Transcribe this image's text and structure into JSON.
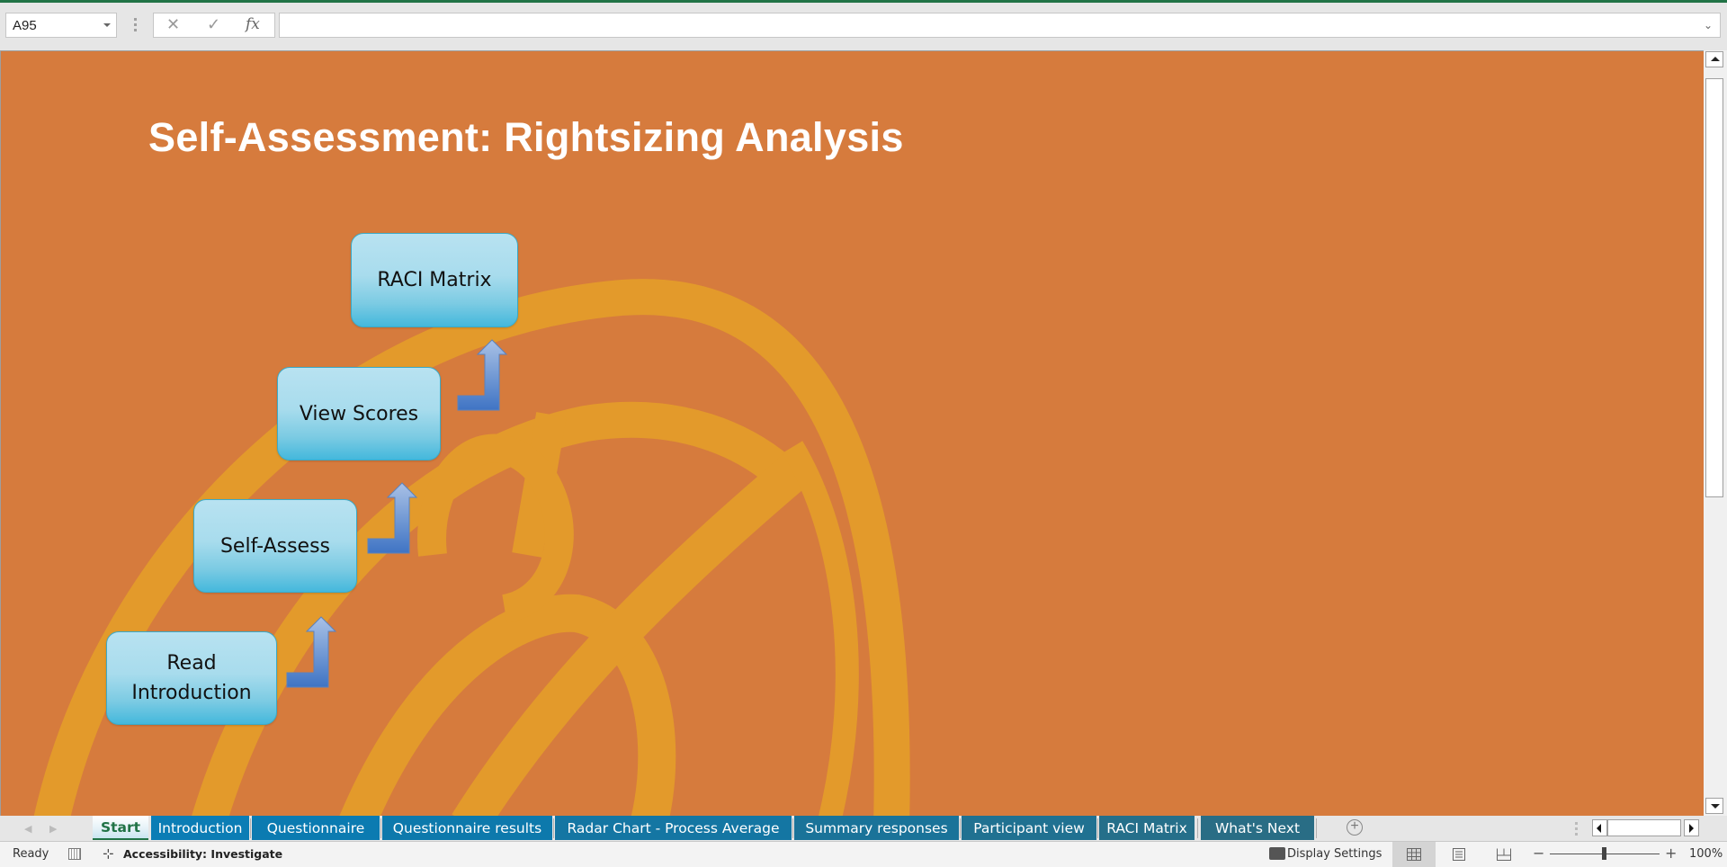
{
  "formula_bar": {
    "name_box": "A95",
    "cancel_icon": "✕",
    "enter_icon": "✓",
    "fx_label": "fx",
    "formula_value": ""
  },
  "sheet": {
    "title": "Self-Assessment: Rightsizing Analysis",
    "background_color": "#d67b3d",
    "swirl_color": "#e39a2b",
    "steps": [
      {
        "label": "Read Introduction"
      },
      {
        "label": "Self-Assess"
      },
      {
        "label": "View Scores"
      },
      {
        "label": "RACI Matrix"
      }
    ]
  },
  "tabs": [
    {
      "label": "Start",
      "active": true
    },
    {
      "label": "Introduction"
    },
    {
      "label": "Questionnaire"
    },
    {
      "label": "Questionnaire results"
    },
    {
      "label": "Radar Chart - Process Average"
    },
    {
      "label": "Summary responses"
    },
    {
      "label": "Participant view"
    },
    {
      "label": "RACI Matrix"
    },
    {
      "label": "What's Next"
    }
  ],
  "tab_bar": {
    "prev_icon": "◀",
    "next_icon": "▶",
    "add_sheet_icon": "+"
  },
  "status_bar": {
    "ready": "Ready",
    "accessibility": "Accessibility: Investigate",
    "display_settings": "Display Settings",
    "zoom_minus": "−",
    "zoom_plus": "+",
    "zoom_level": "100%"
  }
}
